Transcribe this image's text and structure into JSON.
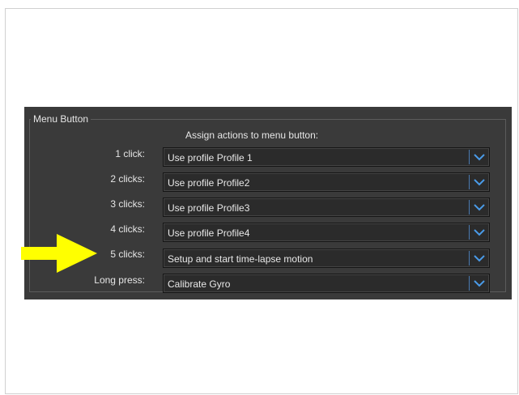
{
  "menu_button": {
    "group_title": "Menu Button",
    "heading": "Assign actions to menu button:",
    "rows": [
      {
        "label": "1 click:",
        "value": "Use profile Profile 1"
      },
      {
        "label": "2 clicks:",
        "value": "Use profile Profile2"
      },
      {
        "label": "3 clicks:",
        "value": "Use profile Profile3"
      },
      {
        "label": "4 clicks:",
        "value": "Use profile Profile4"
      },
      {
        "label": "5 clicks:",
        "value": "Setup and start time-lapse motion"
      },
      {
        "label": "Long press:",
        "value": "Calibrate Gyro"
      }
    ]
  },
  "annotation": {
    "arrow_icon": "right-arrow-icon",
    "arrow_color": "#ffff00",
    "points_to": "5 clicks:"
  },
  "colors": {
    "panel_background": "#3a3a3a",
    "dropdown_background": "#2b2b2b",
    "dropdown_chevron": "#4a9be8"
  }
}
